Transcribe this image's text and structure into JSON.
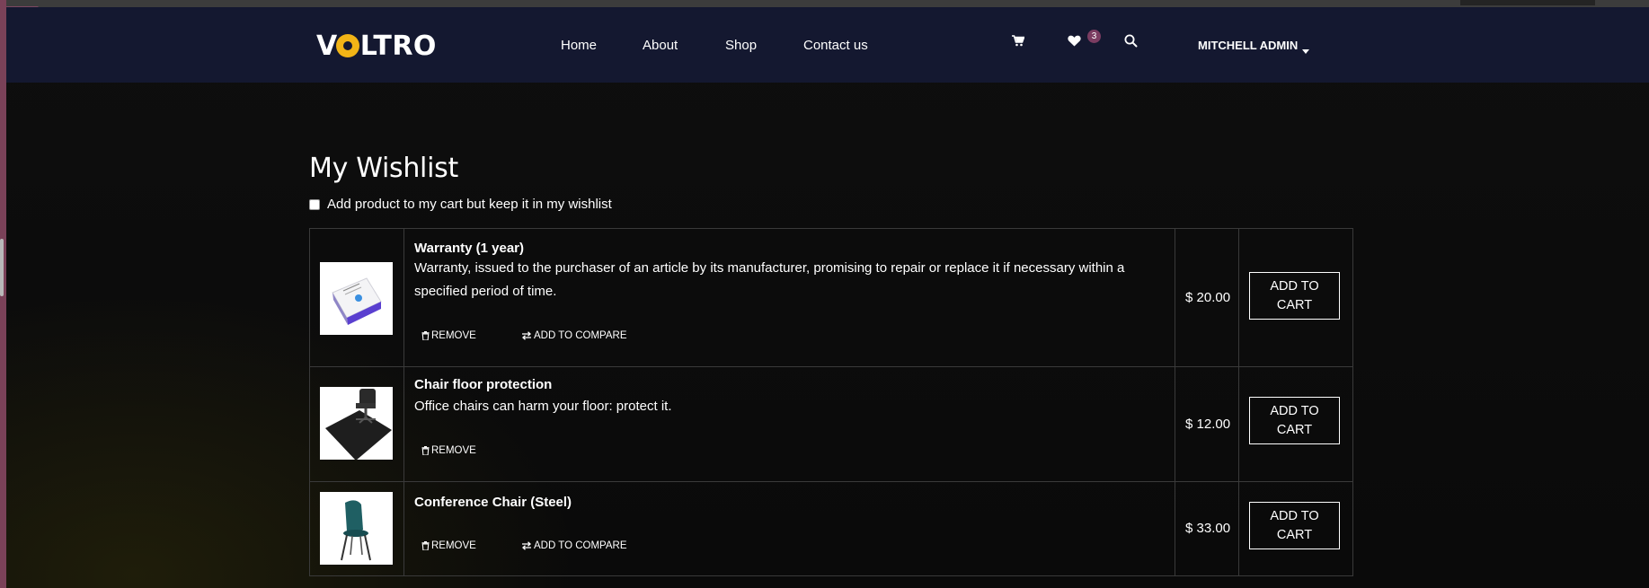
{
  "header": {
    "logo": {
      "pre": "V",
      "post": "LTRO"
    },
    "nav": [
      "Home",
      "About",
      "Shop",
      "Contact us"
    ],
    "wishlist_count": "3",
    "user": "MITCHELL ADMIN"
  },
  "page": {
    "title": "My Wishlist",
    "keep_label": "Add product to my cart but keep it in my wishlist"
  },
  "items": [
    {
      "name": "Warranty (1 year)",
      "desc": "Warranty, issued to the purchaser of an article by its manufacturer, promising to repair or replace it if necessary within a specified period of time.",
      "remove": "REMOVE",
      "compare": "ADD TO COMPARE",
      "price": "$ 20.00",
      "add": "ADD TO CART",
      "icon": "warranty-box-image"
    },
    {
      "name": "Chair floor protection",
      "desc": "Office chairs can harm your floor: protect it.",
      "remove": "REMOVE",
      "price": "$ 12.00",
      "add": "ADD TO CART",
      "icon": "floor-mat-image"
    },
    {
      "name": "Conference Chair (Steel)",
      "desc": "",
      "remove": "REMOVE",
      "compare": "ADD TO COMPARE",
      "price": "$ 33.00",
      "add": "ADD TO CART",
      "icon": "chair-image"
    }
  ],
  "colors": {
    "header_bg": "#141830",
    "badge": "#7b3c61",
    "logo_accent": "#f2b416"
  }
}
